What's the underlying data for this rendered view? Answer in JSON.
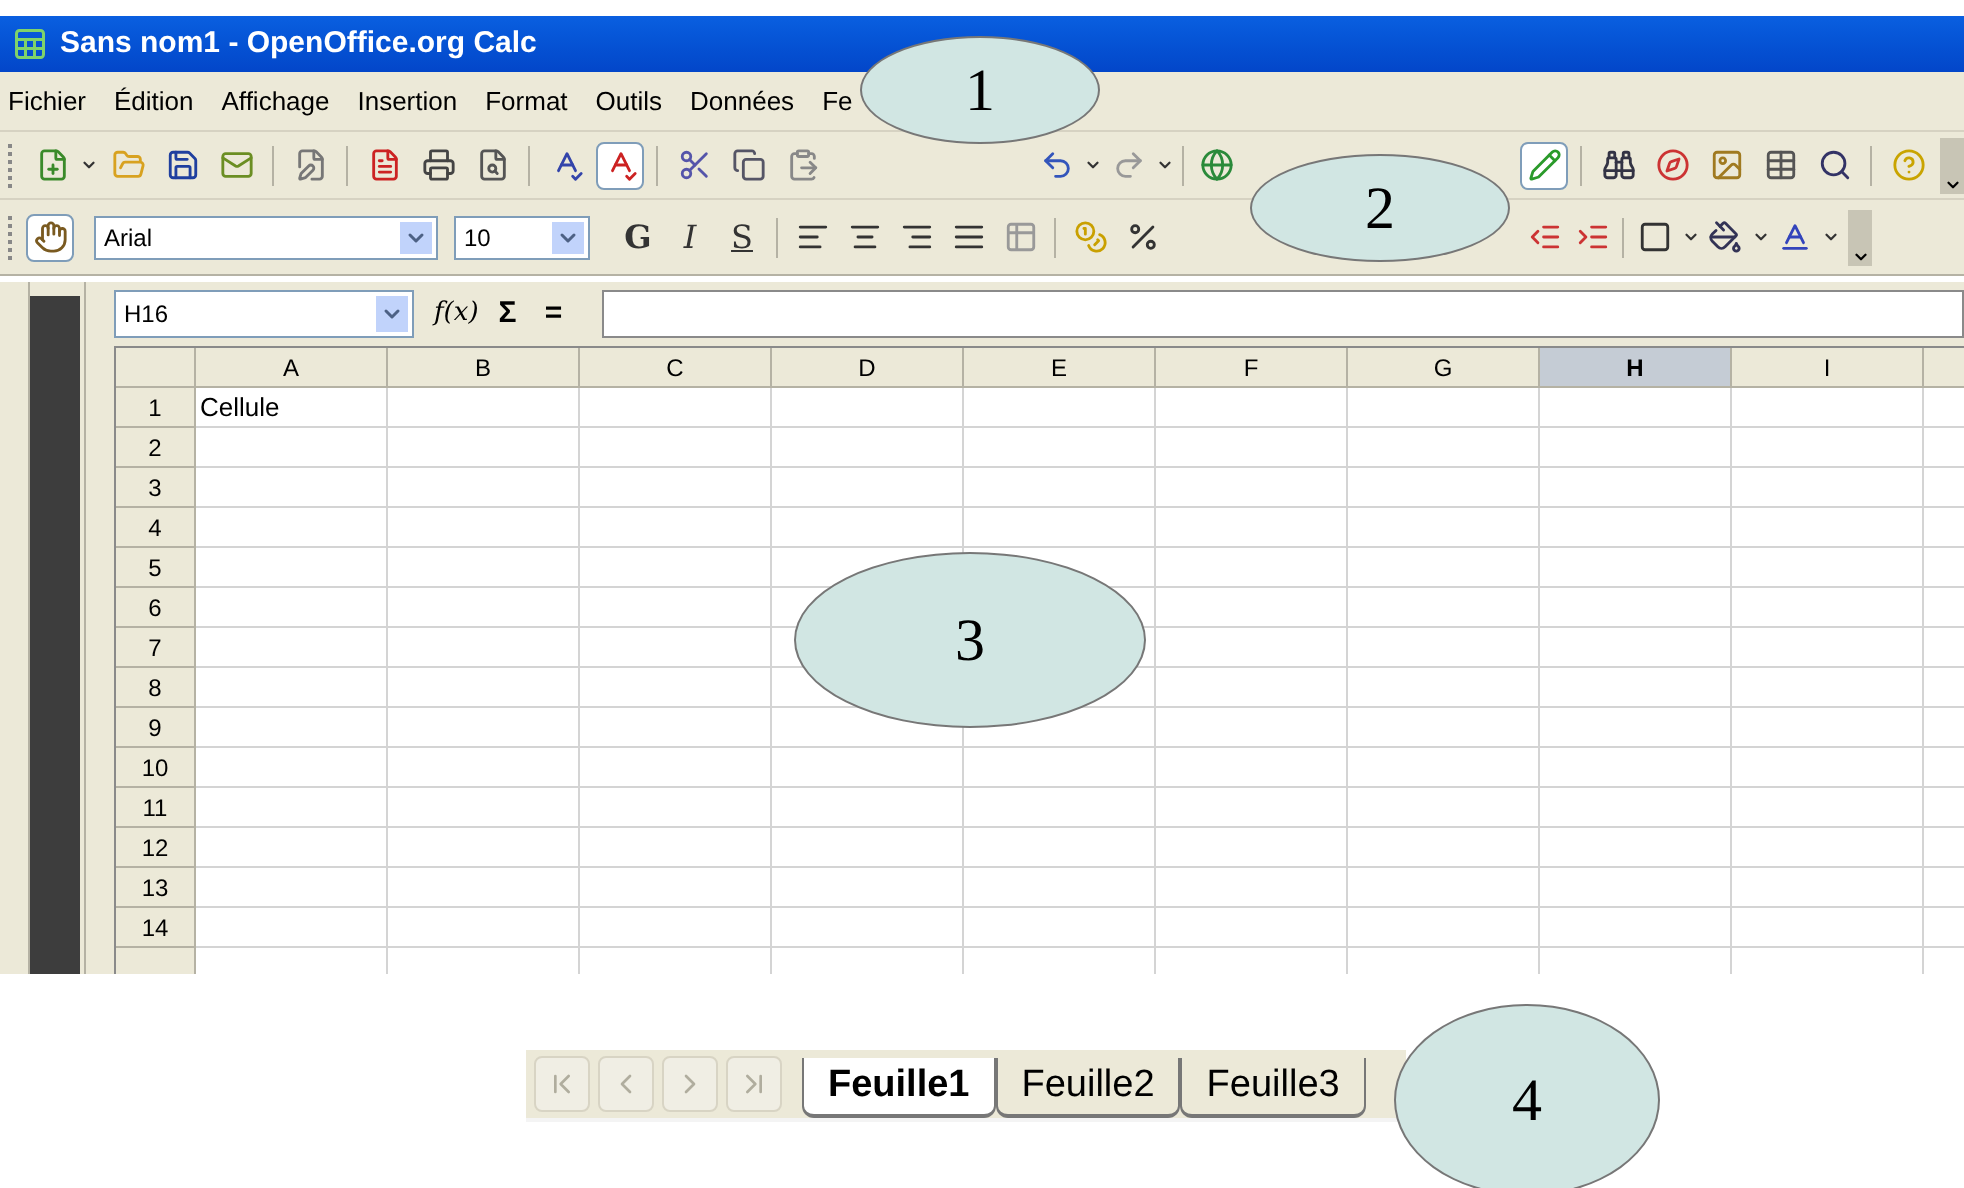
{
  "window": {
    "title": "Sans nom1 - OpenOffice.org Calc"
  },
  "menu": [
    "Fichier",
    "Édition",
    "Affichage",
    "Insertion",
    "Format",
    "Outils",
    "Données",
    "Fe"
  ],
  "toolbar": {
    "autospell_on": true,
    "draw_functions_on": true
  },
  "formatting": {
    "font": "Arial",
    "size": "10",
    "style_buttons": [
      "G",
      "I",
      "S"
    ]
  },
  "formula_bar": {
    "name_box": "H16",
    "function_wizard": "f(x)",
    "sum": "Σ",
    "function": "="
  },
  "sheet": {
    "columns": [
      {
        "label": "A",
        "selected": false
      },
      {
        "label": "B",
        "selected": false
      },
      {
        "label": "C",
        "selected": false
      },
      {
        "label": "D",
        "selected": false
      },
      {
        "label": "E",
        "selected": false
      },
      {
        "label": "F",
        "selected": false
      },
      {
        "label": "G",
        "selected": false
      },
      {
        "label": "H",
        "selected": true
      },
      {
        "label": "I",
        "selected": false
      }
    ],
    "rows": [
      {
        "label": "1",
        "cells": [
          "Cellule"
        ]
      },
      {
        "label": "2"
      },
      {
        "label": "3"
      },
      {
        "label": "4"
      },
      {
        "label": "5"
      },
      {
        "label": "6"
      },
      {
        "label": "7"
      },
      {
        "label": "8"
      },
      {
        "label": "9"
      },
      {
        "label": "10"
      },
      {
        "label": "11"
      },
      {
        "label": "12"
      },
      {
        "label": "13"
      },
      {
        "label": "14"
      }
    ]
  },
  "sheet_tabs": [
    {
      "label": "Feuille1",
      "selected": true
    },
    {
      "label": "Feuille2",
      "selected": false
    },
    {
      "label": "Feuille3",
      "selected": false
    }
  ],
  "callouts": [
    "1",
    "2",
    "3",
    "4"
  ]
}
